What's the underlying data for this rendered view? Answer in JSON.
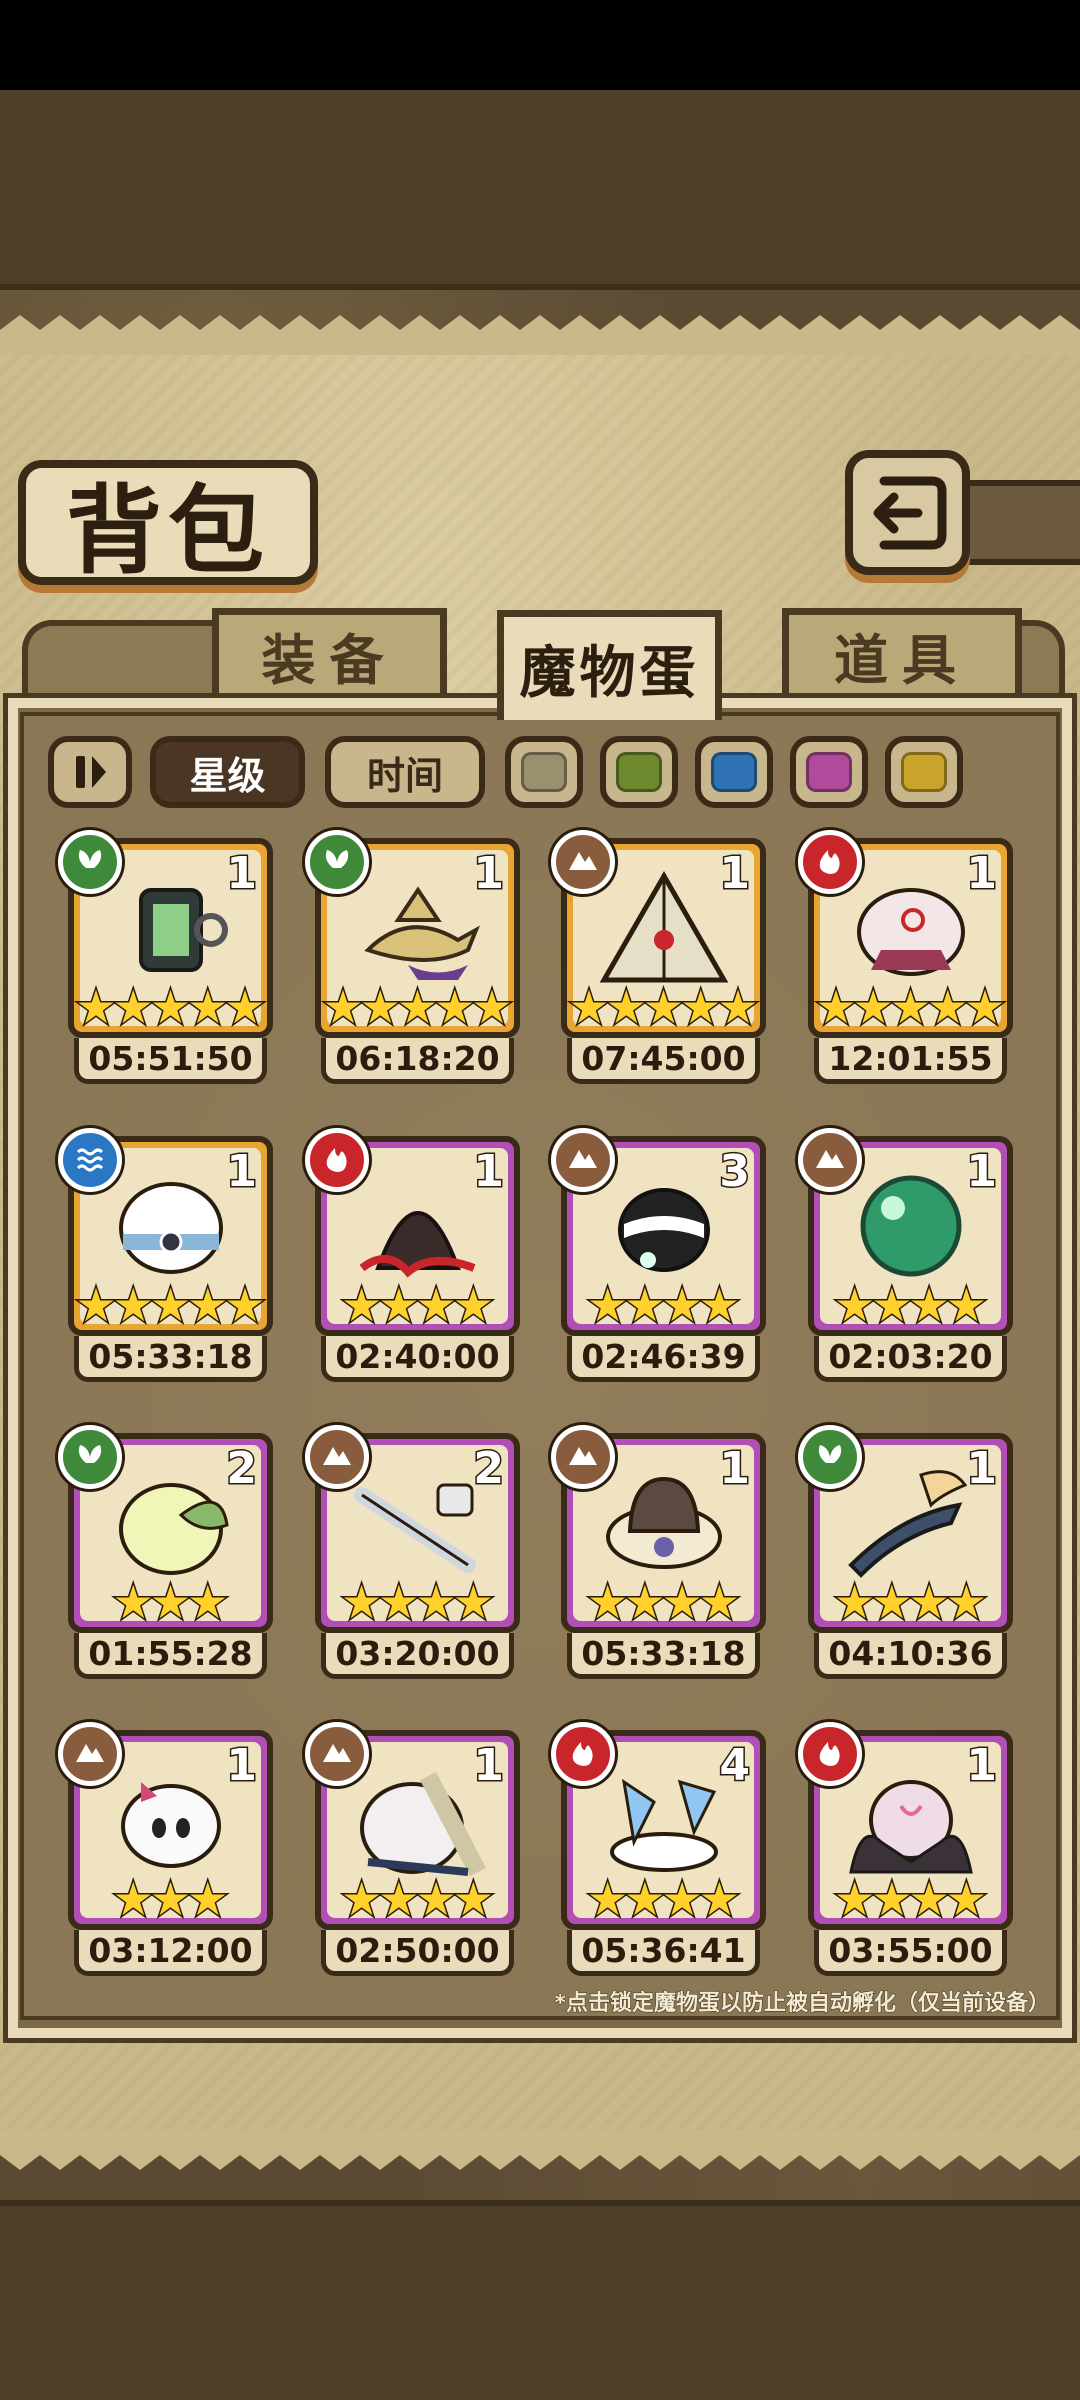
{
  "title": "背包",
  "tabs": [
    {
      "label": "装备",
      "active": false
    },
    {
      "label": "魔物蛋",
      "active": true
    },
    {
      "label": "道具",
      "active": false
    }
  ],
  "filters": {
    "sort_star": "星级",
    "sort_time": "时间",
    "swatches": [
      "#9a9070",
      "#6f8a2e",
      "#2f73b5",
      "#b04a9a",
      "#c9a42a"
    ]
  },
  "colors": {
    "gold_frame": "#e8a531",
    "purple_frame": "#b24fb7",
    "element_nature": "#3f8a3a",
    "element_earth": "#8a5c3e",
    "element_fire": "#c8262a",
    "element_water": "#2a78c4"
  },
  "eggs": [
    {
      "element": "nature",
      "frame": "gold",
      "count": "1",
      "stars": 5,
      "time": "05:51:50",
      "art": "lantern"
    },
    {
      "element": "nature",
      "frame": "gold",
      "count": "1",
      "stars": 5,
      "time": "06:18:20",
      "art": "lamp"
    },
    {
      "element": "earth",
      "frame": "gold",
      "count": "1",
      "stars": 5,
      "time": "07:45:00",
      "art": "pyramid"
    },
    {
      "element": "fire",
      "frame": "gold",
      "count": "1",
      "stars": 5,
      "time": "12:01:55",
      "art": "scale"
    },
    {
      "element": "water",
      "frame": "gold",
      "count": "1",
      "stars": 5,
      "time": "05:33:18",
      "art": "hat"
    },
    {
      "element": "fire",
      "frame": "purple",
      "count": "1",
      "stars": 4,
      "time": "02:40:00",
      "art": "lava"
    },
    {
      "element": "earth",
      "frame": "purple",
      "count": "3",
      "stars": 4,
      "time": "02:46:39",
      "art": "spider"
    },
    {
      "element": "earth",
      "frame": "purple",
      "count": "1",
      "stars": 4,
      "time": "02:03:20",
      "art": "orb"
    },
    {
      "element": "nature",
      "frame": "purple",
      "count": "2",
      "stars": 3,
      "time": "01:55:28",
      "art": "leaf"
    },
    {
      "element": "earth",
      "frame": "purple",
      "count": "2",
      "stars": 4,
      "time": "03:20:00",
      "art": "sword"
    },
    {
      "element": "earth",
      "frame": "purple",
      "count": "1",
      "stars": 4,
      "time": "05:33:18",
      "art": "bowler"
    },
    {
      "element": "nature",
      "frame": "purple",
      "count": "1",
      "stars": 4,
      "time": "04:10:36",
      "art": "blade"
    },
    {
      "element": "earth",
      "frame": "purple",
      "count": "1",
      "stars": 3,
      "time": "03:12:00",
      "art": "skull"
    },
    {
      "element": "earth",
      "frame": "purple",
      "count": "1",
      "stars": 4,
      "time": "02:50:00",
      "art": "wrap"
    },
    {
      "element": "fire",
      "frame": "purple",
      "count": "4",
      "stars": 4,
      "time": "05:36:41",
      "art": "ice"
    },
    {
      "element": "fire",
      "frame": "purple",
      "count": "1",
      "stars": 4,
      "time": "03:55:00",
      "art": "bat"
    }
  ],
  "hint": "*点击锁定魔物蛋以防止被自动孵化（仅当前设备）"
}
